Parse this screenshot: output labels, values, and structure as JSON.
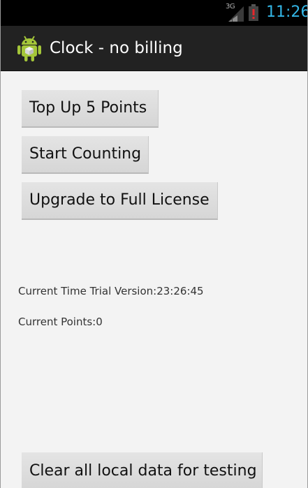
{
  "status_bar": {
    "network_label": "3G",
    "time": "11:26",
    "clock_color": "#33b5e5",
    "signal_icon": "signal-bars-icon",
    "battery_icon": "battery-low-icon"
  },
  "action_bar": {
    "title": "Clock - no billing",
    "icon": "android-app-icon"
  },
  "buttons": {
    "top_up": "Top Up 5 Points",
    "start_counting": "Start Counting",
    "upgrade": "Upgrade to Full License",
    "clear_data": "Clear all local data for testing"
  },
  "info": {
    "current_time": "Current Time Trial Version:23:26:45",
    "current_points": "Current Points:0"
  }
}
